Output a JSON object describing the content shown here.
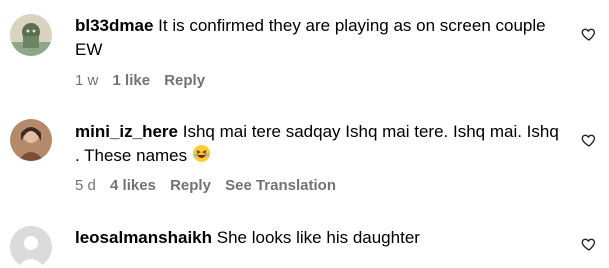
{
  "comments": [
    {
      "username": "bl33dmae",
      "text_line1": "It is confirmed they are playing as on screen couple",
      "text_line2": "EW",
      "time": "1 w",
      "likes": "1 like",
      "reply": "Reply",
      "avatar_icon": "avatar-illustration-icon"
    },
    {
      "username": "mini_iz_here",
      "text_line1": "Ishq mai tere sadqay Ishq mai tere. Ishq mai. Ishq",
      "text_line2": ". These names",
      "emoji": "laughing-emoji-icon",
      "time": "5 d",
      "likes": "4 likes",
      "reply": "Reply",
      "translation": "See Translation",
      "avatar_icon": "avatar-photo-icon"
    },
    {
      "username": "leosalmanshaikh",
      "text_line1": "She looks like his daughter",
      "avatar_icon": "default-avatar-icon"
    }
  ],
  "colors": {
    "meta": "#737373",
    "text": "#000000"
  }
}
